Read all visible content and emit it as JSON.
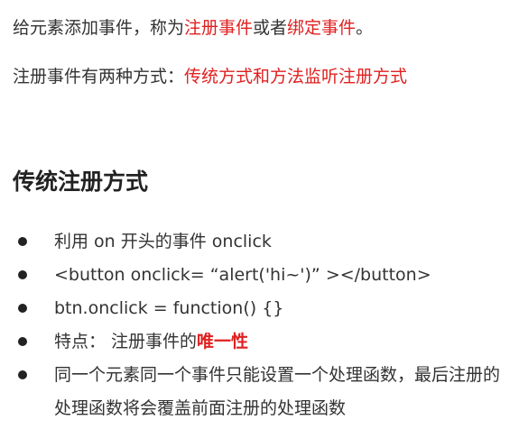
{
  "intro": {
    "line1": {
      "prefix": "给元素添加事件，称为",
      "term1": "注册事件",
      "middle": "或者",
      "term2": "绑定事件",
      "suffix": "。"
    },
    "line2": {
      "prefix": "注册事件有两种方式：",
      "highlight": "传统方式和方法监听注册方式"
    }
  },
  "section": {
    "heading": "传统注册方式",
    "bullets": [
      {
        "text": "利用 on 开头的事件 onclick"
      },
      {
        "text": "<button onclick= “alert('hi~')” ></button>"
      },
      {
        "text": "btn.onclick = function() {}"
      },
      {
        "prefix": "特点： 注册事件的",
        "highlight": "唯一性"
      },
      {
        "text": "同一个元素同一个事件只能设置一个处理函数，最后注册的处理函数将会覆盖前面注册的处理函数"
      }
    ]
  },
  "colors": {
    "highlight": "#e02020",
    "text": "#333333",
    "bullet": "#222222"
  }
}
